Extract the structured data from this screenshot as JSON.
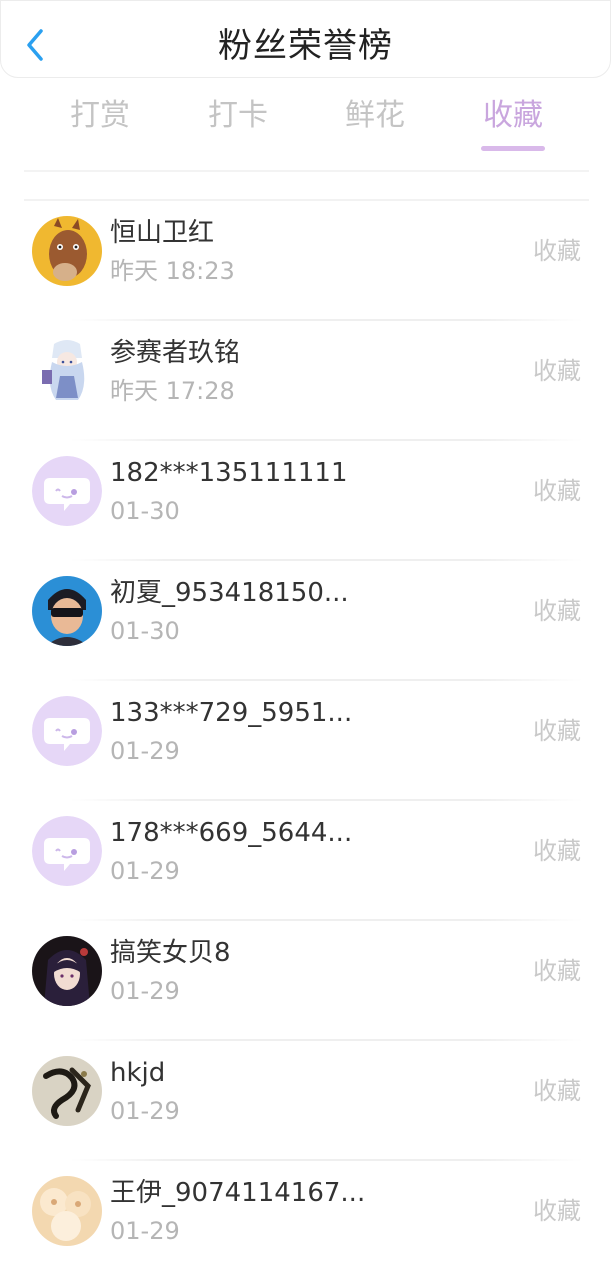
{
  "header": {
    "title": "粉丝荣誉榜"
  },
  "tabs": [
    {
      "label": "打赏",
      "active": false
    },
    {
      "label": "打卡",
      "active": false
    },
    {
      "label": "鲜花",
      "active": false
    },
    {
      "label": "收藏",
      "active": true
    }
  ],
  "colors": {
    "accent": "#c9a6de",
    "back_arrow": "#2aa0f0"
  },
  "rows": [
    {
      "name": "恒山卫红",
      "time": "昨天 18:23",
      "action": "收藏",
      "avatar": "cartoon-horse"
    },
    {
      "name": "参赛者玖铭",
      "time": "昨天 17:28",
      "action": "收藏",
      "avatar": "anime-girl-white"
    },
    {
      "name": "182***135111111",
      "time": "01-30",
      "action": "收藏",
      "avatar": "default-chat-bubble"
    },
    {
      "name": "初夏_953418150...",
      "time": "01-30",
      "action": "收藏",
      "avatar": "cartoon-boy"
    },
    {
      "name": "133***729_5951...",
      "time": "01-29",
      "action": "收藏",
      "avatar": "default-chat-bubble"
    },
    {
      "name": "178***669_5644...",
      "time": "01-29",
      "action": "收藏",
      "avatar": "default-chat-bubble"
    },
    {
      "name": "搞笑女贝8",
      "time": "01-29",
      "action": "收藏",
      "avatar": "anime-girl-dark"
    },
    {
      "name": "hkjd",
      "time": "01-29",
      "action": "收藏",
      "avatar": "calligraphy"
    },
    {
      "name": "王伊_9074114167...",
      "time": "01-29",
      "action": "收藏",
      "avatar": "food-buns"
    }
  ]
}
